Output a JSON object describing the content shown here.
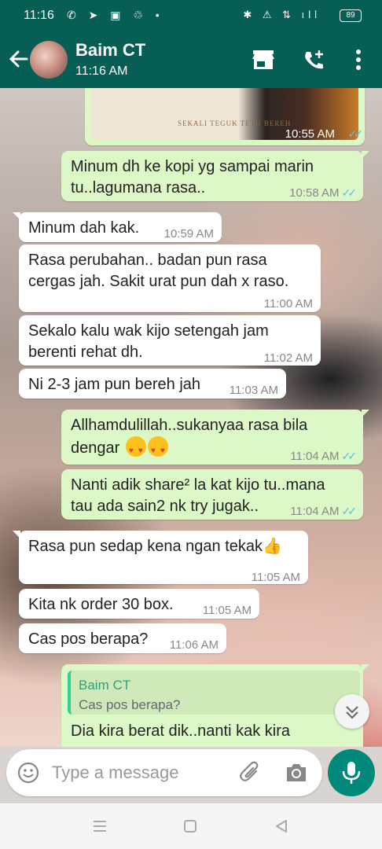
{
  "statusbar": {
    "time": "11:16",
    "left_icons": "✆ ➤ ▣ ♲ •",
    "right_icons": "✱ ⚠ ⇅ ıll",
    "battery": "89"
  },
  "header": {
    "contact_name": "Baim CT",
    "status": "11:16 AM"
  },
  "image_message": {
    "caption_in_image": "SEKALI TEGUK TETU BEREH",
    "time": "10:55 AM",
    "ticks": "✓✓"
  },
  "messages": [
    {
      "dir": "out",
      "text1": "Minum dh ke kopi yg sampai marin",
      "text2": "tu..lagumana rasa..",
      "time": "10:58 AM",
      "ticks": "✓✓"
    },
    {
      "dir": "in",
      "text1": "Minum dah kak.",
      "time": "10:59 AM"
    },
    {
      "dir": "in",
      "text1": "Rasa perubahan.. badan pun rasa",
      "text2": "cergas jah. Sakit urat pun dah x raso.",
      "time": "11:00 AM"
    },
    {
      "dir": "in",
      "text1": "Sekalo kalu wak kijo setengah jam",
      "text2": "berenti rehat dh.",
      "time": "11:02 AM"
    },
    {
      "dir": "in",
      "text1": "Ni 2-3 jam pun bereh jah",
      "time": "11:03 AM"
    },
    {
      "dir": "out",
      "text1": "Allhamdulillah..sukanyaa rasa bila",
      "text2": "dengar",
      "time": "11:04 AM",
      "ticks": "✓✓"
    },
    {
      "dir": "out",
      "text1": "Nanti adik share² la kat kijo tu..mana",
      "text2": "tau ada sain2 nk try jugak..",
      "time": "11:04 AM",
      "ticks": "✓✓"
    },
    {
      "dir": "in",
      "text1": "Rasa pun sedap kena ngan tekak👍",
      "time": "11:05 AM"
    },
    {
      "dir": "in",
      "text1": "Kita nk order 30 box.",
      "time": "11:05 AM"
    },
    {
      "dir": "in",
      "text1": "Cas pos berapa?",
      "time": "11:06 AM"
    }
  ],
  "reply_message": {
    "quoted_name": "Baim CT",
    "quoted_text": "Cas pos berapa?",
    "text": "Dia kira berat dik..nanti kak kira"
  },
  "input": {
    "placeholder": "Type a message"
  },
  "colors": {
    "header": "#075e54",
    "outgoing_bubble": "#dcf8c6",
    "incoming_bubble": "#ffffff",
    "accent": "#00897b",
    "read_ticks": "#4fc3f7"
  },
  "icons": [
    "back-arrow-icon",
    "shop-icon",
    "add-call-icon",
    "more-options-icon",
    "emoji-icon",
    "attach-icon",
    "camera-icon",
    "mic-icon",
    "scroll-down-icon"
  ]
}
